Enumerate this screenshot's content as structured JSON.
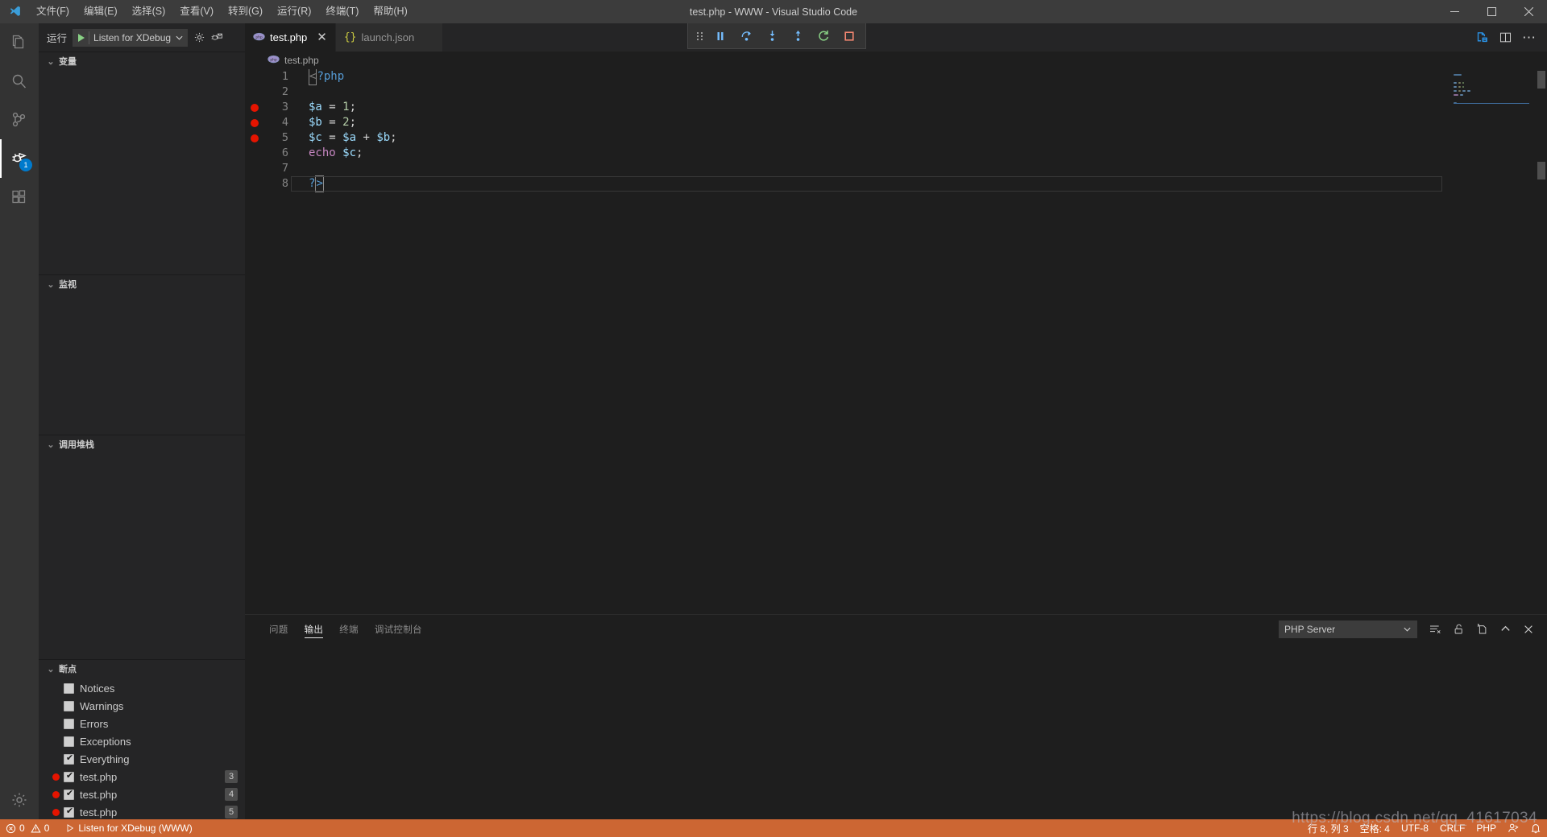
{
  "window": {
    "title": "test.php - WWW - Visual Studio Code",
    "minimize": "—",
    "maximize": "▢",
    "close": "✕"
  },
  "menubar": {
    "items": [
      {
        "label": "文件(F)",
        "name": "menu-file"
      },
      {
        "label": "编辑(E)",
        "name": "menu-edit"
      },
      {
        "label": "选择(S)",
        "name": "menu-selection"
      },
      {
        "label": "查看(V)",
        "name": "menu-view"
      },
      {
        "label": "转到(G)",
        "name": "menu-go"
      },
      {
        "label": "运行(R)",
        "name": "menu-run"
      },
      {
        "label": "终端(T)",
        "name": "menu-terminal"
      },
      {
        "label": "帮助(H)",
        "name": "menu-help"
      }
    ]
  },
  "activitybar": {
    "items": [
      {
        "icon": "files-explorer-icon",
        "active": false,
        "badge": ""
      },
      {
        "icon": "search-icon",
        "active": false,
        "badge": ""
      },
      {
        "icon": "source-control-icon",
        "active": false,
        "badge": ""
      },
      {
        "icon": "run-and-debug-icon",
        "active": true,
        "badge": "1"
      },
      {
        "icon": "extensions-icon",
        "active": false,
        "badge": ""
      }
    ],
    "settings_icon": "gear-icon"
  },
  "sidebar": {
    "toolbar": {
      "run_label": "运行",
      "config_name": "Listen for XDebug",
      "gear_icon": "gear-icon",
      "open_debug_console_icon": "debug-console-icon"
    },
    "sections": [
      {
        "title": "变量",
        "name": "variables"
      },
      {
        "title": "监视",
        "name": "watch"
      },
      {
        "title": "调用堆栈",
        "name": "call-stack"
      },
      {
        "title": "断点",
        "name": "breakpoints"
      }
    ],
    "breakpoints": [
      {
        "label": "Notices",
        "checked": false,
        "has_dot": false,
        "line": ""
      },
      {
        "label": "Warnings",
        "checked": false,
        "has_dot": false,
        "line": ""
      },
      {
        "label": "Errors",
        "checked": false,
        "has_dot": false,
        "line": ""
      },
      {
        "label": "Exceptions",
        "checked": false,
        "has_dot": false,
        "line": ""
      },
      {
        "label": "Everything",
        "checked": true,
        "has_dot": false,
        "line": ""
      },
      {
        "label": "test.php",
        "checked": true,
        "has_dot": true,
        "line": "3"
      },
      {
        "label": "test.php",
        "checked": true,
        "has_dot": true,
        "line": "4"
      },
      {
        "label": "test.php",
        "checked": true,
        "has_dot": true,
        "line": "5"
      }
    ]
  },
  "debug_toolbar": {
    "buttons": [
      {
        "name": "drag-handle-icon",
        "title": "drag"
      },
      {
        "name": "pause-icon",
        "title": "暂停",
        "color": "#75beff"
      },
      {
        "name": "step-over-icon",
        "title": "单步跳过",
        "color": "#75beff"
      },
      {
        "name": "step-into-icon",
        "title": "单步调试",
        "color": "#75beff"
      },
      {
        "name": "step-out-icon",
        "title": "单步跳出",
        "color": "#75beff"
      },
      {
        "name": "restart-icon",
        "title": "重启",
        "color": "#89d185"
      },
      {
        "name": "stop-icon",
        "title": "停止",
        "color": "#f48771"
      }
    ]
  },
  "editor": {
    "tabs": [
      {
        "label": "test.php",
        "icon": "php-file-icon",
        "active": true,
        "close": "✕"
      },
      {
        "label": "launch.json",
        "icon": "json-file-icon",
        "active": false,
        "close": "✕"
      }
    ],
    "actions": [
      {
        "name": "run-php-server-icon"
      },
      {
        "name": "split-editor-icon"
      },
      {
        "name": "more-actions-icon",
        "label": "⋯"
      }
    ],
    "breadcrumb": {
      "label": "test.php",
      "icon": "php-file-icon"
    },
    "code_lines": [
      {
        "num": "1",
        "breakpoint": false,
        "tokens": [
          {
            "t": "<",
            "c": "kw-punct",
            "cursor": true
          },
          {
            "t": "?php",
            "c": "kw-tag"
          }
        ]
      },
      {
        "num": "2",
        "breakpoint": false,
        "tokens": []
      },
      {
        "num": "3",
        "breakpoint": true,
        "tokens": [
          {
            "t": "$a",
            "c": "kw-var"
          },
          {
            "t": " = ",
            "c": "kw-op"
          },
          {
            "t": "1",
            "c": "kw-num"
          },
          {
            "t": ";",
            "c": "kw-semi"
          }
        ]
      },
      {
        "num": "4",
        "breakpoint": true,
        "tokens": [
          {
            "t": "$b",
            "c": "kw-var"
          },
          {
            "t": " = ",
            "c": "kw-op"
          },
          {
            "t": "2",
            "c": "kw-num"
          },
          {
            "t": ";",
            "c": "kw-semi"
          }
        ]
      },
      {
        "num": "5",
        "breakpoint": true,
        "tokens": [
          {
            "t": "$c",
            "c": "kw-var"
          },
          {
            "t": " = ",
            "c": "kw-op"
          },
          {
            "t": "$a",
            "c": "kw-var"
          },
          {
            "t": " + ",
            "c": "kw-op"
          },
          {
            "t": "$b",
            "c": "kw-var"
          },
          {
            "t": ";",
            "c": "kw-semi"
          }
        ]
      },
      {
        "num": "6",
        "breakpoint": false,
        "tokens": [
          {
            "t": "echo",
            "c": "kw-echo"
          },
          {
            "t": " ",
            "c": "kw-op"
          },
          {
            "t": "$c",
            "c": "kw-var"
          },
          {
            "t": ";",
            "c": "kw-semi"
          }
        ]
      },
      {
        "num": "7",
        "breakpoint": false,
        "tokens": []
      },
      {
        "num": "8",
        "breakpoint": false,
        "current": true,
        "tokens": [
          {
            "t": "?",
            "c": "kw-tag"
          },
          {
            "t": ">",
            "c": "kw-tag",
            "cursor": true
          }
        ]
      }
    ]
  },
  "panel": {
    "tabs": [
      {
        "label": "问题",
        "active": false,
        "name": "tab-problems"
      },
      {
        "label": "输出",
        "active": true,
        "name": "tab-output"
      },
      {
        "label": "终端",
        "active": false,
        "name": "tab-terminal"
      },
      {
        "label": "调试控制台",
        "active": false,
        "name": "tab-debug-console"
      }
    ],
    "output_channel": "PHP Server",
    "chevron": "⌄",
    "actions": [
      {
        "name": "clear-output-icon"
      },
      {
        "name": "lock-scroll-icon"
      },
      {
        "name": "open-in-editor-icon"
      },
      {
        "name": "maximize-panel-icon"
      },
      {
        "name": "close-panel-icon"
      }
    ],
    "content": ""
  },
  "statusbar": {
    "errors": "0",
    "warnings": "0",
    "debug_session": "Listen for XDebug (WWW)",
    "cursor_position": "行 8, 列 3",
    "indentation": "空格: 4",
    "encoding": "UTF-8",
    "eol": "CRLF",
    "language": "PHP",
    "feedback_icon": "feedback-smiley-icon",
    "notifications_icon": "bell-icon"
  },
  "watermark": "https://blog.csdn.net/qq_41617034",
  "colors": {
    "accent": "#007acc",
    "status_debug_bg": "#cc6633",
    "breakpoint_red": "#e51400",
    "editor_bg": "#1e1e1e",
    "sidebar_bg": "#252526",
    "activitybar_bg": "#333333",
    "titlebar_bg": "#3c3c3c"
  }
}
